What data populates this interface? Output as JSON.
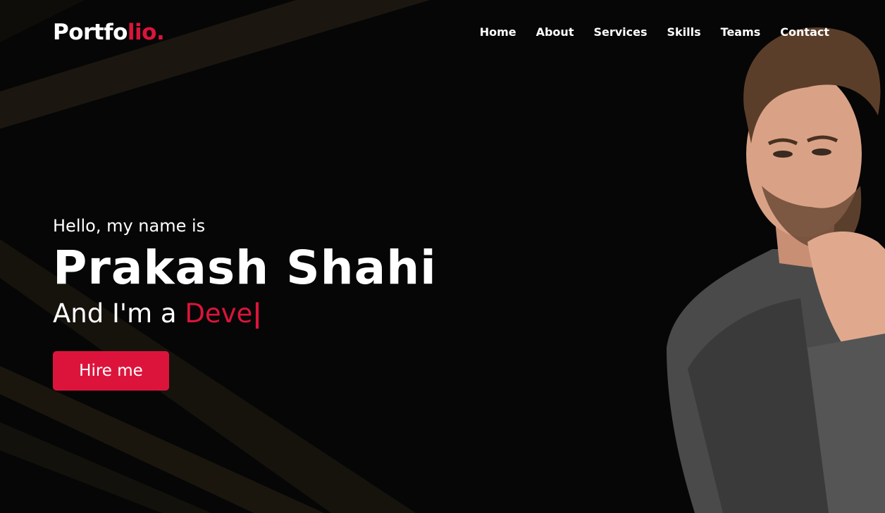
{
  "colors": {
    "background": "#060606",
    "accent": "#dc143c",
    "text": "#ffffff"
  },
  "logo": {
    "prefix": "Portfo",
    "accent_text": "lio."
  },
  "nav": {
    "items": [
      {
        "label": "Home"
      },
      {
        "label": "About"
      },
      {
        "label": "Services"
      },
      {
        "label": "Skills"
      },
      {
        "label": "Teams"
      },
      {
        "label": "Contact"
      }
    ]
  },
  "hero": {
    "intro": "Hello, my name is",
    "name": "Prakash Shahi",
    "role_prefix": "And I'm a ",
    "role_typed": "Deve",
    "cursor": "|",
    "cta_label": "Hire me",
    "photo_icon": "portrait-photo"
  }
}
